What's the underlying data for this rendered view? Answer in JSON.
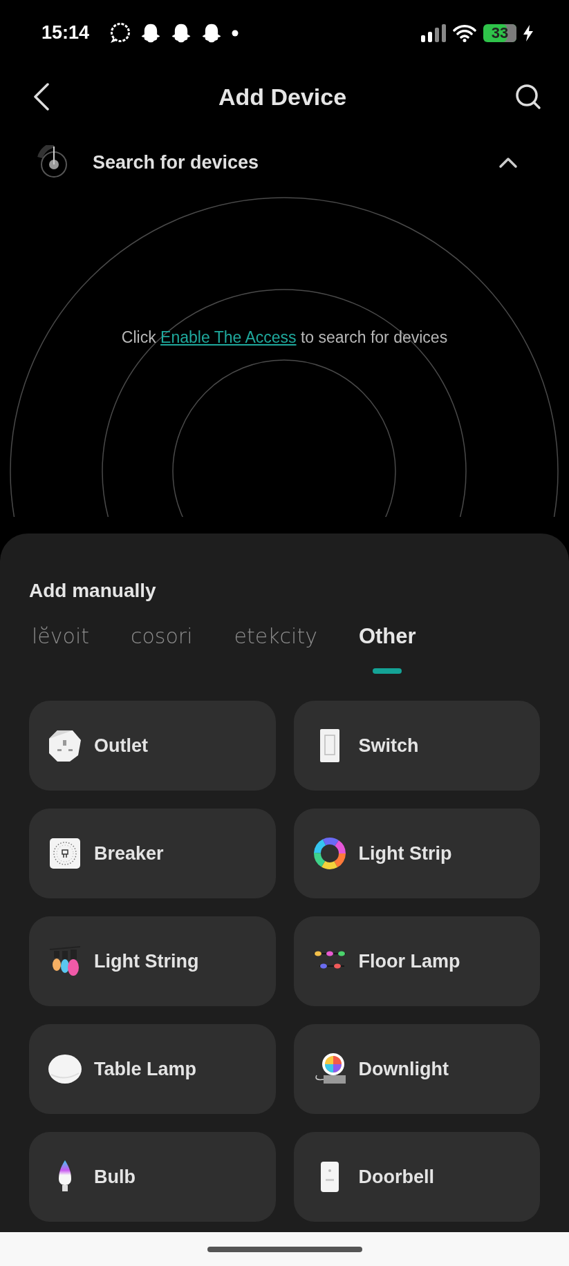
{
  "status_bar": {
    "time": "15:14",
    "battery": "33",
    "charging": true
  },
  "header": {
    "title": "Add Device"
  },
  "search_section": {
    "label": "Search for devices",
    "expanded": true,
    "message": {
      "prefix": "Click",
      "link": "Enable The Access",
      "suffix": "to search for devices"
    }
  },
  "manual": {
    "title": "Add manually",
    "tabs": [
      {
        "label": "lĕvoit",
        "selected": false
      },
      {
        "label": "cosori",
        "selected": false
      },
      {
        "label": "etekcity",
        "selected": false
      },
      {
        "label": "Other",
        "selected": true
      }
    ],
    "devices": [
      {
        "label": "Outlet"
      },
      {
        "label": "Switch"
      },
      {
        "label": "Breaker"
      },
      {
        "label": "Light Strip"
      },
      {
        "label": "Light String"
      },
      {
        "label": "Floor Lamp"
      },
      {
        "label": "Table Lamp"
      },
      {
        "label": "Downlight"
      },
      {
        "label": "Bulb"
      },
      {
        "label": "Doorbell"
      }
    ]
  }
}
